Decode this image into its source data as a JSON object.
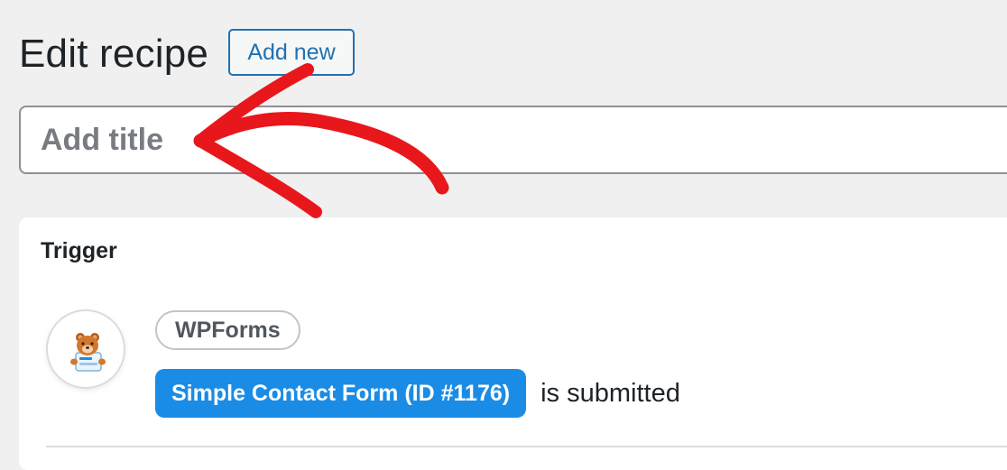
{
  "header": {
    "page_title": "Edit recipe",
    "add_new_label": "Add new"
  },
  "title_field": {
    "placeholder": "Add title",
    "value": ""
  },
  "trigger_panel": {
    "heading": "Trigger",
    "integration_name": "WPForms",
    "integration_icon": "wpforms-bear-icon",
    "form_token": "Simple Contact Form (ID #1176)",
    "suffix": "is submitted"
  },
  "annotation": {
    "icon": "red-arrow-annotation-icon",
    "color": "#e8171b"
  },
  "colors": {
    "accent": "#2271b1",
    "token_bg": "#1a8ce6",
    "page_bg": "#f0f0f1"
  }
}
